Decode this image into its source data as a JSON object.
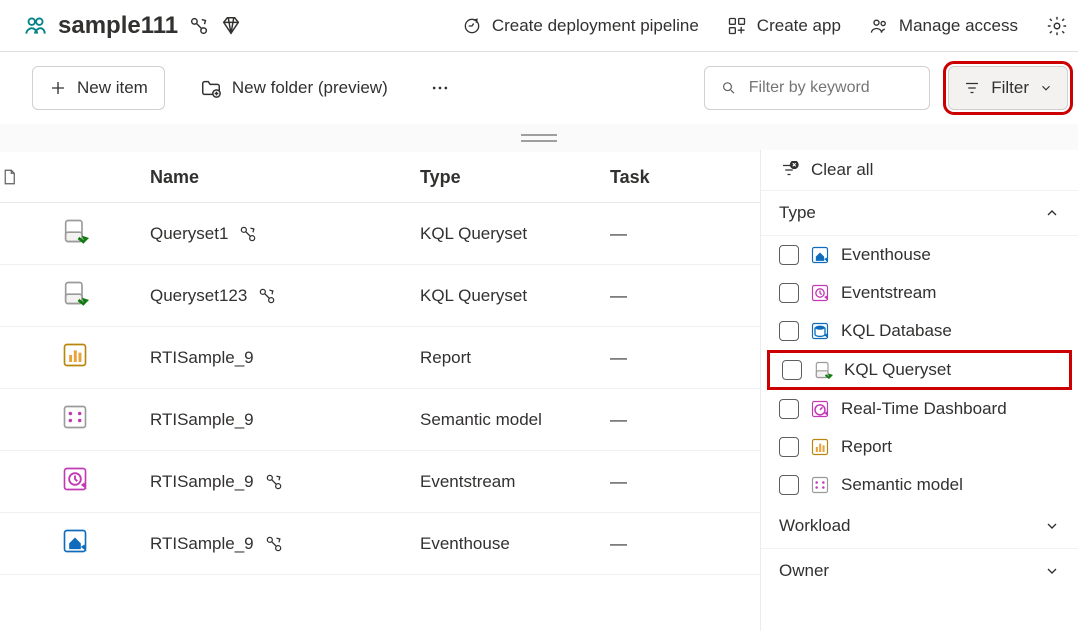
{
  "header": {
    "workspace_name": "sample111",
    "actions": {
      "pipeline": "Create deployment pipeline",
      "create_app": "Create app",
      "manage_access": "Manage access"
    }
  },
  "toolbar": {
    "new_item": "New item",
    "new_folder": "New folder (preview)",
    "search_placeholder": "Filter by keyword",
    "filter_label": "Filter"
  },
  "table": {
    "headers": {
      "name": "Name",
      "type": "Type",
      "task": "Task"
    },
    "rows": [
      {
        "icon": "queryset",
        "name": "Queryset1",
        "badge": true,
        "type": "KQL Queryset",
        "task": "—"
      },
      {
        "icon": "queryset",
        "name": "Queryset123",
        "badge": true,
        "type": "KQL Queryset",
        "task": "—"
      },
      {
        "icon": "report",
        "name": "RTISample_9",
        "badge": false,
        "type": "Report",
        "task": "—"
      },
      {
        "icon": "semantic",
        "name": "RTISample_9",
        "badge": false,
        "type": "Semantic model",
        "task": "—"
      },
      {
        "icon": "eventstream",
        "name": "RTISample_9",
        "badge": true,
        "type": "Eventstream",
        "task": "—"
      },
      {
        "icon": "eventhouse",
        "name": "RTISample_9",
        "badge": true,
        "type": "Eventhouse",
        "task": "—"
      }
    ]
  },
  "filter_panel": {
    "clear_all": "Clear all",
    "sections": {
      "type": {
        "label": "Type",
        "expanded": true,
        "options": [
          {
            "icon": "eventhouse",
            "label": "Eventhouse",
            "highlighted": false
          },
          {
            "icon": "eventstream",
            "label": "Eventstream",
            "highlighted": false
          },
          {
            "icon": "kqldb",
            "label": "KQL Database",
            "highlighted": false
          },
          {
            "icon": "queryset",
            "label": "KQL Queryset",
            "highlighted": true
          },
          {
            "icon": "rtdashboard",
            "label": "Real-Time Dashboard",
            "highlighted": false
          },
          {
            "icon": "report",
            "label": "Report",
            "highlighted": false
          },
          {
            "icon": "semantic",
            "label": "Semantic model",
            "highlighted": false
          }
        ]
      },
      "workload": {
        "label": "Workload",
        "expanded": false
      },
      "owner": {
        "label": "Owner",
        "expanded": false
      }
    }
  }
}
